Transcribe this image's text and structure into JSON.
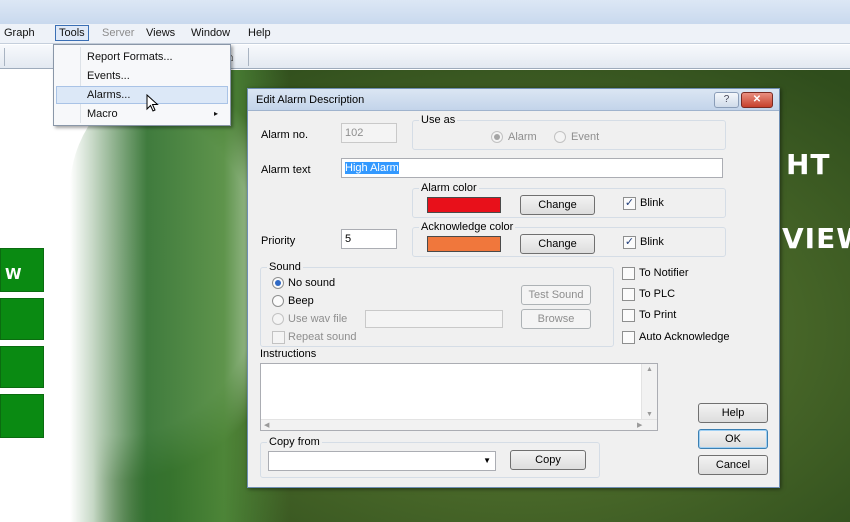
{
  "menubar": {
    "items": [
      {
        "label": "Graph",
        "state": "normal"
      },
      {
        "label": "Tools",
        "state": "active"
      },
      {
        "label": "Server",
        "state": "disabled"
      },
      {
        "label": "Views",
        "state": "normal"
      },
      {
        "label": "Window",
        "state": "normal"
      },
      {
        "label": "Help",
        "state": "normal"
      }
    ]
  },
  "tools_menu": {
    "items": [
      {
        "label": "Report Formats..."
      },
      {
        "label": "Events..."
      },
      {
        "label": "Alarms...",
        "state": "hover"
      },
      {
        "label": "Macro",
        "submenu": "▸"
      }
    ]
  },
  "background": {
    "words": [
      "HT",
      "VIEW"
    ],
    "side_button_label": "W"
  },
  "dialog": {
    "title": "Edit Alarm Description",
    "title_buttons": {
      "help": "?",
      "close": "✕"
    },
    "alarm_no": {
      "label": "Alarm no.",
      "value": "102"
    },
    "use_as": {
      "title": "Use as",
      "options": [
        {
          "label": "Alarm",
          "checked": true
        },
        {
          "label": "Event",
          "checked": false
        }
      ]
    },
    "alarm_text": {
      "label": "Alarm text",
      "value": "High Alarm"
    },
    "alarm_color": {
      "title": "Alarm color",
      "color": "#e8101a",
      "change_label": "Change",
      "blink_label": "Blink",
      "blink_checked": true
    },
    "acknowledge_color": {
      "title": "Acknowledge color",
      "color": "#f0773c",
      "change_label": "Change",
      "blink_label": "Blink",
      "blink_checked": true
    },
    "priority": {
      "label": "Priority",
      "value": "5"
    },
    "sound": {
      "title": "Sound",
      "options": [
        {
          "label": "No sound",
          "checked": true,
          "enabled": true
        },
        {
          "label": "Beep",
          "checked": false,
          "enabled": true
        },
        {
          "label": "Use wav file",
          "checked": false,
          "enabled": false
        }
      ],
      "wav_file_value": "",
      "test_sound_label": "Test Sound",
      "browse_label": "Browse",
      "repeat_label": "Repeat sound"
    },
    "targets": [
      {
        "label": "To Notifier",
        "checked": false
      },
      {
        "label": "To PLC",
        "checked": false
      },
      {
        "label": "To Print",
        "checked": false
      },
      {
        "label": "Auto Acknowledge",
        "checked": false
      }
    ],
    "instructions": {
      "label": "Instructions",
      "value": ""
    },
    "copy_from": {
      "title": "Copy from",
      "value": "",
      "copy_label": "Copy"
    },
    "buttons": {
      "help": "Help",
      "ok": "OK",
      "cancel": "Cancel"
    }
  }
}
